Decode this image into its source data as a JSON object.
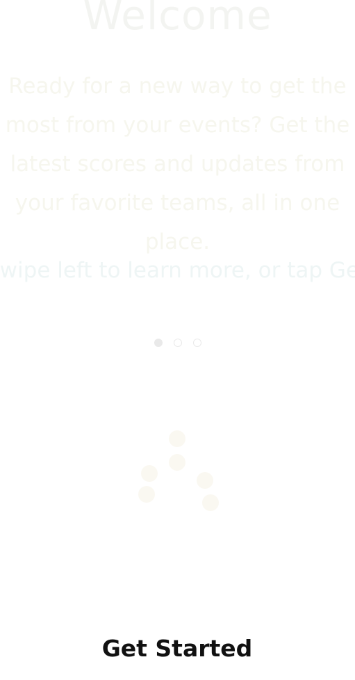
{
  "onboarding": {
    "title": "Welcome",
    "intro": "Ready for a new way to get the most from your events? Get the latest scores and updates from your favorite teams, all in one place.",
    "tagline": "Swipe left to learn more, or tap Get Started to begin",
    "pager": {
      "pages": 3,
      "active": 1
    },
    "cta_label": "Get Started"
  },
  "colors": {
    "background": "#ffffff",
    "faded_text": "#f3f4f1",
    "dot": "#e9e9e9",
    "cta_text": "#111111"
  }
}
